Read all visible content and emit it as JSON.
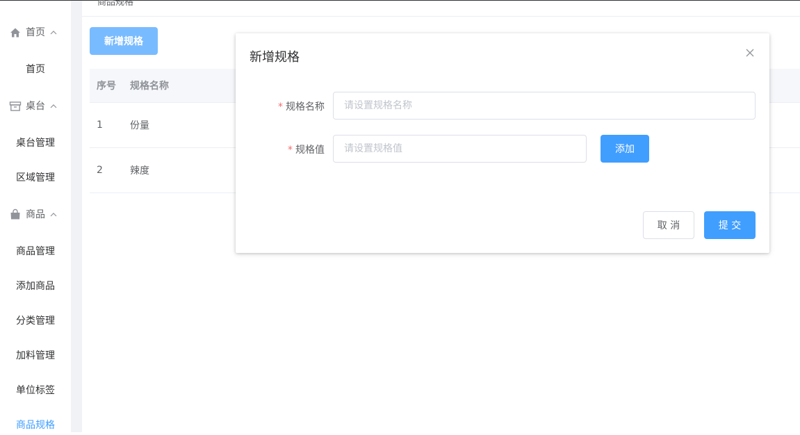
{
  "breadcrumb": {
    "current": "商品规格"
  },
  "sidebar": {
    "groups": [
      {
        "label": "首页",
        "icon": "home-icon",
        "items": [
          {
            "label": "首页"
          }
        ]
      },
      {
        "label": "桌台",
        "icon": "box-icon",
        "items": [
          {
            "label": "桌台管理"
          },
          {
            "label": "区域管理"
          }
        ]
      },
      {
        "label": "商品",
        "icon": "bag-icon",
        "items": [
          {
            "label": "商品管理"
          },
          {
            "label": "添加商品"
          },
          {
            "label": "分类管理"
          },
          {
            "label": "加料管理"
          },
          {
            "label": "单位标签"
          },
          {
            "label": "商品规格"
          }
        ]
      }
    ],
    "active_item": "商品规格"
  },
  "toolbar": {
    "add_spec_label": "新增规格"
  },
  "table": {
    "headers": [
      "序号",
      "规格名称"
    ],
    "rows": [
      {
        "no": "1",
        "name": "份量"
      },
      {
        "no": "2",
        "name": "辣度"
      }
    ]
  },
  "dialog": {
    "title": "新增规格",
    "fields": {
      "spec_name": {
        "label": "规格名称",
        "required_mark": "*",
        "placeholder": "请设置规格名称",
        "value": ""
      },
      "spec_value": {
        "label": "规格值",
        "required_mark": "*",
        "placeholder": "请设置规格值",
        "value": ""
      }
    },
    "add_label": "添加",
    "cancel_label": "取 消",
    "submit_label": "提 交"
  },
  "colors": {
    "primary": "#409eff",
    "primary_light": "#79bbff",
    "required": "#f56c6c",
    "active_menu": "#409eff"
  }
}
